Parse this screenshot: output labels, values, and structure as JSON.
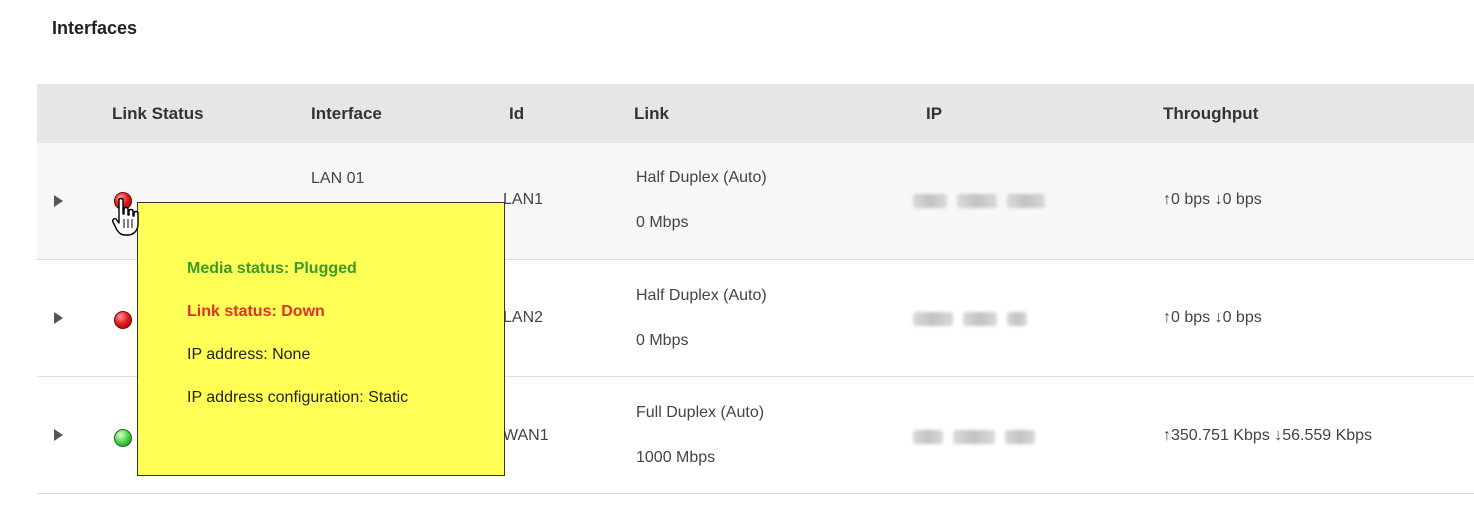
{
  "section": {
    "title": "Interfaces"
  },
  "table": {
    "headers": [
      "Link Status",
      "Interface",
      "Id",
      "Link",
      "IP",
      "Throughput"
    ],
    "rows": [
      {
        "status": "red",
        "interface": "LAN 01",
        "id": "LAN1",
        "duplex": "Half Duplex (Auto)",
        "speed": "0 Mbps",
        "throughput": "↑0 bps ↓0 bps"
      },
      {
        "status": "red",
        "interface": "",
        "id": "LAN2",
        "duplex": "Half Duplex (Auto)",
        "speed": "0 Mbps",
        "throughput": "↑0 bps ↓0 bps"
      },
      {
        "status": "green",
        "interface": "",
        "id": "WAN1",
        "duplex": "Full Duplex (Auto)",
        "speed": "1000 Mbps",
        "throughput": "↑350.751 Kbps ↓56.559 Kbps"
      }
    ]
  },
  "tooltip": {
    "media_status": "Media status: Plugged",
    "link_status": "Link status: Down",
    "ip_address": "IP address: None",
    "ip_config": "IP address configuration: Static"
  },
  "colors": {
    "header_bg": "#e6e6e6",
    "tooltip_bg": "#ffff55",
    "media_ok": "#3a9a2a",
    "link_down": "#e0302a",
    "led_red": "#e02020",
    "led_green": "#4ed34a"
  },
  "icons": {
    "expander": "triangle-right-icon",
    "cursor": "hand-pointer-icon"
  }
}
